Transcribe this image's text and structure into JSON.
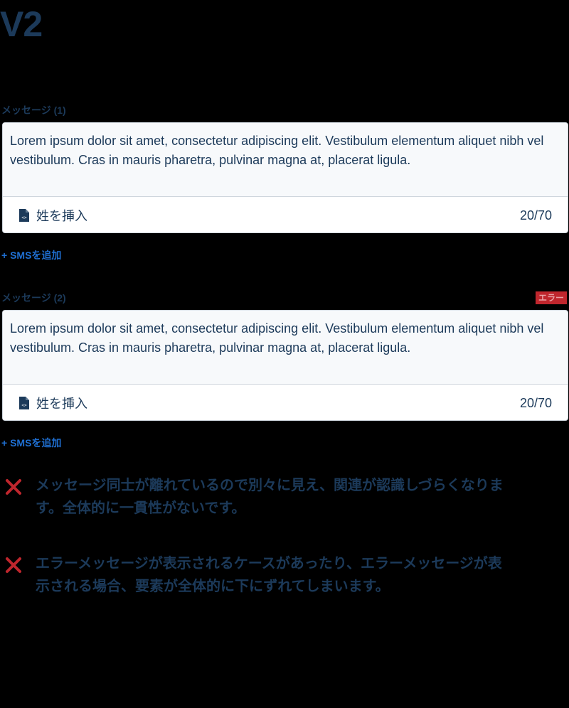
{
  "page": {
    "title": "V2"
  },
  "colors": {
    "text": "#1c3a5a",
    "link": "#1f6fd1",
    "error": "#c0262d",
    "card_bg": "#f7f9fb",
    "border": "#cfd6dd"
  },
  "examples": [
    {
      "label": "メッセージ (1)",
      "badge": "",
      "body": "Lorem ipsum dolor sit amet, consectetur adipiscing elit. Vestibulum elementum aliquet nibh vel vestibulum. Cras in mauris pharetra, pulvinar magna at, placerat ligula.",
      "insert_label": "姓を挿入",
      "insert_icon": "document-code-icon",
      "count": "20/70",
      "add_link": "+ SMSを追加"
    },
    {
      "label": "メッセージ (2)",
      "badge": "エラー",
      "body": "Lorem ipsum dolor sit amet, consectetur adipiscing elit. Vestibulum elementum aliquet nibh vel vestibulum. Cras in mauris pharetra, pulvinar magna at, placerat ligula.",
      "insert_label": "姓を挿入",
      "insert_icon": "document-code-icon",
      "count": "20/70",
      "add_link": "+ SMSを追加"
    }
  ],
  "notes": [
    {
      "icon": "cross-icon",
      "text": "メッセージ同士が離れているので別々に見え、関連が認識しづらくなります。全体的に一貫性がないです。"
    },
    {
      "icon": "cross-icon",
      "text": "エラーメッセージが表示されるケースがあったり、エラーメッセージが表示される場合、要素が全体的に下にずれてしまいます。"
    }
  ]
}
